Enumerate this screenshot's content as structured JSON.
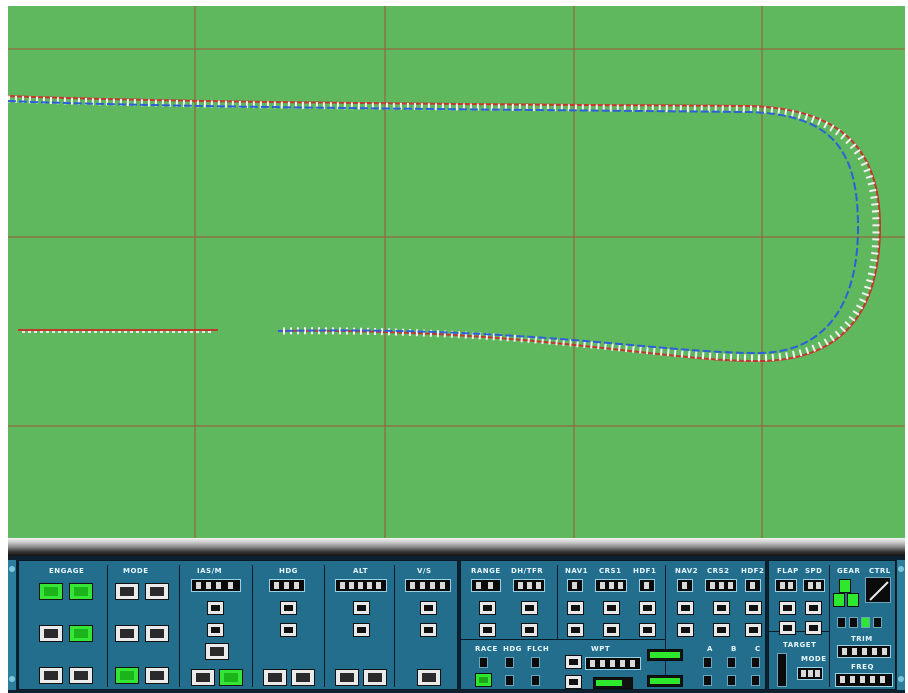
{
  "map": {
    "background_color": "#5fb85e",
    "grid_color": "#b03a2e",
    "path_colors": {
      "route": "#c0392b",
      "track": "#2e5fd8",
      "ties": "#f2f2f2"
    }
  },
  "panel": {
    "sections": {
      "engage": "ENGAGE",
      "mode": "MODE",
      "ias": "IAS/M",
      "hdg": "HDG",
      "alt": "ALT",
      "vs": "V/S",
      "range": "RANGE",
      "dh_tfr": "DH/TFR",
      "nav1": "NAV1",
      "crs1": "CRS1",
      "hdf1": "HDF1",
      "nav2": "NAV2",
      "crs2": "CRS2",
      "hdf2": "HDF2",
      "flap": "FLAP",
      "spd": "SPD",
      "gear": "GEAR",
      "ctrl": "CTRL",
      "target": "TARGET",
      "mode2": "MODE",
      "trim": "TRIM",
      "freq": "FREQ",
      "wpt": "WPT",
      "race": "RACE",
      "hdg2": "HDG",
      "flch": "FLCH",
      "a": "A",
      "b": "B",
      "c": "C"
    }
  }
}
